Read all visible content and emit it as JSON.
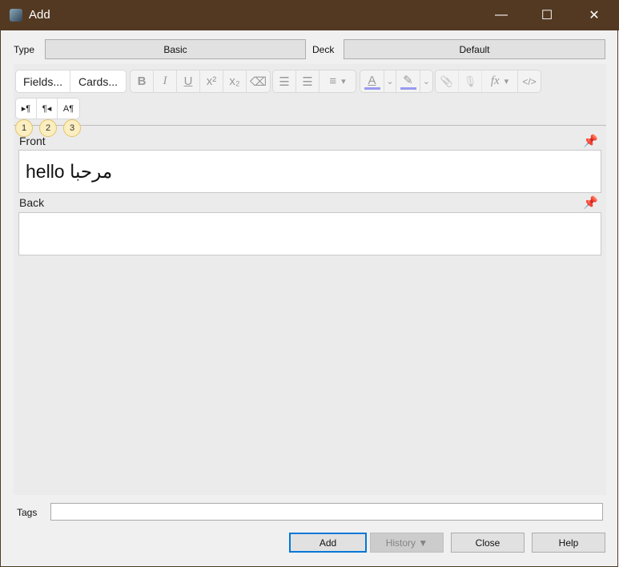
{
  "window": {
    "title": "Add",
    "minimize": "—",
    "maximize": "☐",
    "close": "✕"
  },
  "type": {
    "label": "Type",
    "value": "Basic"
  },
  "deck": {
    "label": "Deck",
    "value": "Default"
  },
  "toolbar": {
    "fields": "Fields...",
    "cards": "Cards...",
    "bold": "B",
    "italic": "I",
    "underline": "U",
    "superscript": "x²",
    "subscript": "x₂",
    "eraser": "⌫",
    "ul": "☰",
    "ol": "☰",
    "align": "≡",
    "caret": "▾",
    "chev": "⌄",
    "text_color": "A",
    "highlight": "✎",
    "attach": "📎",
    "mic": "🎙",
    "fx": "fx",
    "html": "</>",
    "ltr": "▸¶",
    "rtl": "¶◂",
    "direction": "A¶",
    "colors": {
      "text_color": "#9a9af0",
      "highlight": "#9a9af0"
    }
  },
  "badges": [
    "1",
    "2",
    "3"
  ],
  "fields": [
    {
      "label": "Front",
      "value": "hello مرحبا"
    },
    {
      "label": "Back",
      "value": ""
    }
  ],
  "tags": {
    "label": "Tags",
    "value": ""
  },
  "buttons": {
    "add": "Add",
    "history": "History ▼",
    "close": "Close",
    "help": "Help"
  }
}
